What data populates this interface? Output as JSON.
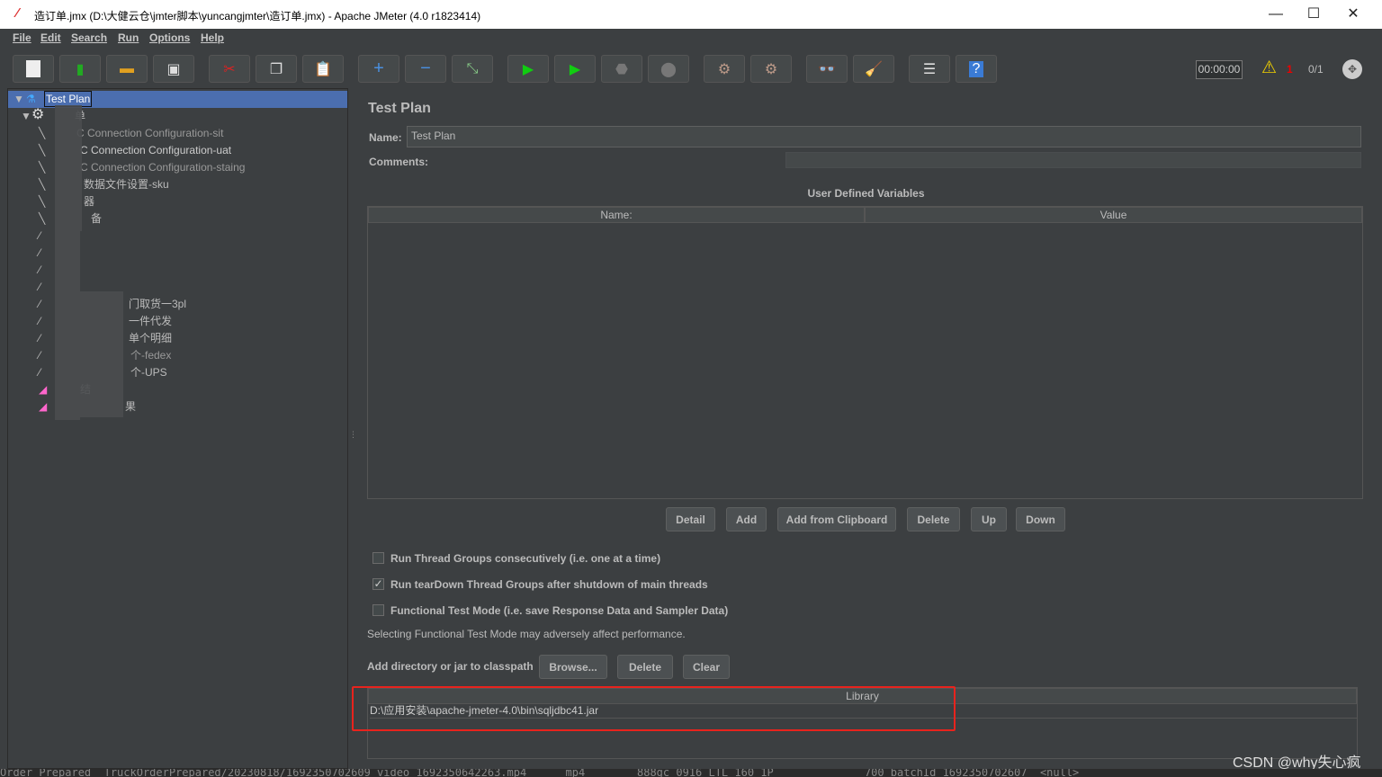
{
  "window": {
    "title": "造订单.jmx (D:\\大健云仓\\jmter脚本\\yuncangjmter\\造订单.jmx) - Apache JMeter (4.0 r1823414)"
  },
  "menu": [
    "File",
    "Edit",
    "Search",
    "Run",
    "Options",
    "Help"
  ],
  "toolbar": {
    "buttons": [
      "new-icon",
      "templates-icon",
      "open-icon",
      "save-icon",
      "cut-icon",
      "copy-icon",
      "paste-icon",
      "expand-icon",
      "collapse-icon",
      "toggle-icon",
      "start-icon",
      "start-no-pauses-icon",
      "stop-icon",
      "shutdown-icon",
      "clear-icon",
      "clear-all-icon",
      "search-icon",
      "reset-search-icon",
      "function-helper-icon",
      "help-icon"
    ],
    "timer": "00:00:00",
    "warning_count": "1",
    "threads": "0/1"
  },
  "tree": {
    "items": [
      {
        "label": "Test Plan",
        "selected": true
      },
      {
        "label": "单"
      },
      {
        "label": "C Connection Configuration-sit"
      },
      {
        "label": "C Connection Configuration-uat"
      },
      {
        "label": "C Connection Configuration-staing"
      },
      {
        "label": "数据文件设置-sku"
      },
      {
        "label": "器"
      },
      {
        "label": "备"
      },
      {
        "label": "门取货一3pl"
      },
      {
        "label": "一件代发"
      },
      {
        "label": "单个明细"
      },
      {
        "label": "个-fedex"
      },
      {
        "label": "个-UPS"
      },
      {
        "label": "结"
      },
      {
        "label": "果"
      }
    ]
  },
  "panel": {
    "title": "Test Plan",
    "name_label": "Name:",
    "name_value": "Test Plan",
    "comments_label": "Comments:",
    "udv_title": "User Defined Variables",
    "udv_columns": [
      "Name:",
      "Value"
    ],
    "udv_buttons": [
      "Detail",
      "Add",
      "Add from Clipboard",
      "Delete",
      "Up",
      "Down"
    ],
    "options": [
      {
        "label": "Run Thread Groups consecutively (i.e. one at a time)",
        "checked": false
      },
      {
        "label": "Run tearDown Thread Groups after shutdown of main threads",
        "checked": true
      },
      {
        "label": "Functional Test Mode (i.e. save Response Data and Sampler Data)",
        "checked": false
      }
    ],
    "functional_note": "Selecting Functional Test Mode may adversely affect performance.",
    "classpath_label": "Add directory or jar to classpath",
    "classpath_buttons": [
      "Browse...",
      "Delete",
      "Clear"
    ],
    "library_header": "Library",
    "library_rows": [
      "D:\\应用安装\\apache-jmeter-4.0\\bin\\sqljdbc41.jar"
    ],
    "highlight_color": "#e8231d"
  },
  "watermark": "CSDN @why失心疯",
  "background_text": "Order_Prepared  TruckOrderPrepared/20230818/1692350702609_video_1692350642263.mp4      mp4        888gc_0916_LTL_160_1P              700_batchId_1692350702607  <null>"
}
